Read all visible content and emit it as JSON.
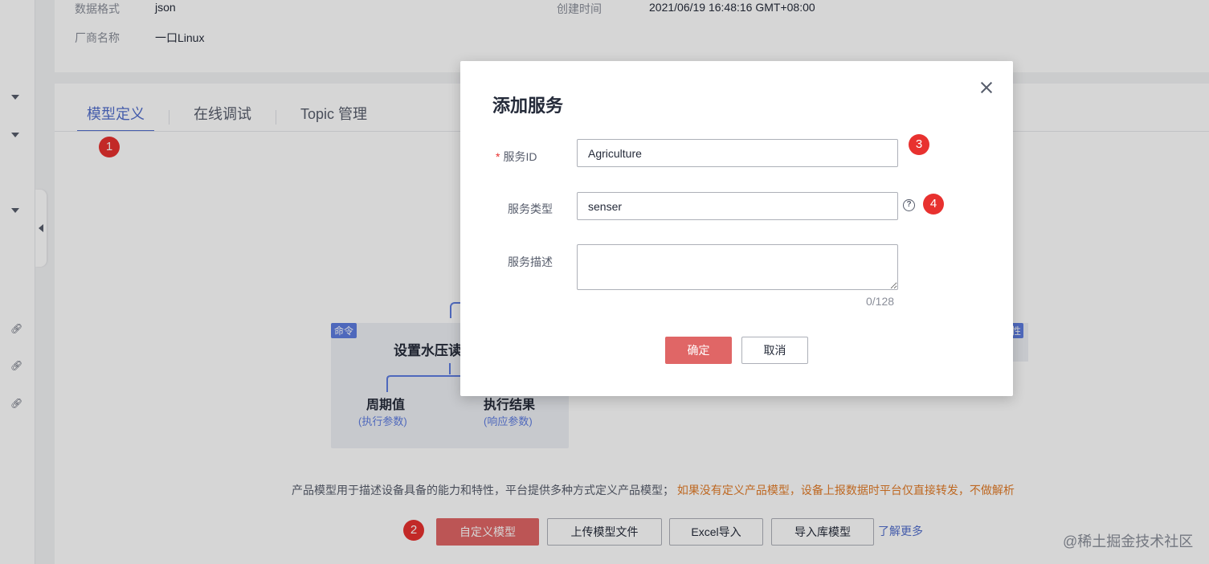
{
  "info": {
    "data_format_label": "数据格式",
    "data_format_value": "json",
    "created_label": "创建时间",
    "created_value": "2021/06/19 16:48:16 GMT+08:00",
    "vendor_label": "厂商名称",
    "vendor_value": "一口Linux"
  },
  "tabs": [
    {
      "label": "模型定义",
      "active": true
    },
    {
      "label": "在线调试",
      "active": false
    },
    {
      "label": "Topic 管理",
      "active": false
    }
  ],
  "badges": [
    "1",
    "2",
    "3",
    "4"
  ],
  "illustration": {
    "tag_command": "命令",
    "main_text": "设置水压读",
    "left_text": "周期值",
    "left_sub": "(执行参数)",
    "right_text": "执行结果",
    "right_sub": "(响应参数)",
    "right_tag": "性"
  },
  "description": {
    "normal": "产品模型用于描述设备具备的能力和特性，平台提供多种方式定义产品模型；",
    "warning": "如果没有定义产品模型，设备上报数据时平台仅直接转发，不做解析"
  },
  "actions": {
    "custom_model": "自定义模型",
    "upload_model": "上传模型文件",
    "excel_import": "Excel导入",
    "library_import": "导入库模型",
    "learn_more": "了解更多"
  },
  "watermark": "@稀土掘金技术社区",
  "dialog": {
    "title": "添加服务",
    "service_id_label": "服务ID",
    "service_id_value": "Agriculture",
    "service_type_label": "服务类型",
    "service_type_value": "senser",
    "service_desc_label": "服务描述",
    "service_desc_value": "",
    "counter": "0/128",
    "confirm": "确定",
    "cancel": "取消"
  },
  "colors": {
    "accent": "#526ecc",
    "primary_button": "#e06666",
    "badge": "#e8312f",
    "warning": "#e37d29"
  }
}
